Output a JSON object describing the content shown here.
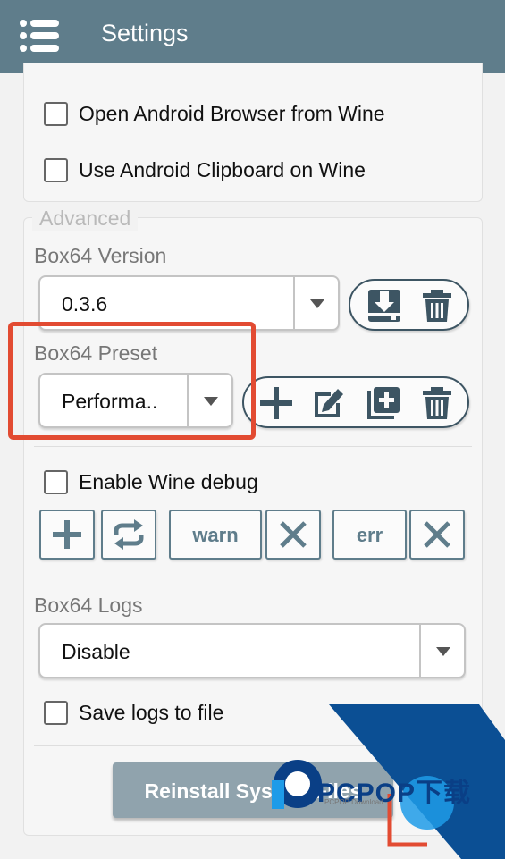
{
  "header": {
    "title": "Settings",
    "menu_icon": "menu-icon"
  },
  "wine_options": {
    "open_browser_label": "Open Android Browser from Wine",
    "open_browser_checked": false,
    "clipboard_label": "Use Android Clipboard on Wine",
    "clipboard_checked": false
  },
  "advanced": {
    "legend": "Advanced",
    "box64_version": {
      "label": "Box64 Version",
      "value": "0.3.6",
      "actions": [
        "download-icon",
        "trash-icon"
      ]
    },
    "box64_preset": {
      "label": "Box64 Preset",
      "value": "Performa..",
      "actions": [
        "plus-icon",
        "edit-icon",
        "duplicate-icon",
        "trash-icon"
      ]
    },
    "wine_debug": {
      "label": "Enable Wine debug",
      "checked": false,
      "channels": [
        "warn",
        "err"
      ]
    },
    "box64_logs": {
      "label": "Box64 Logs",
      "value": "Disable",
      "save_label": "Save logs to file",
      "save_checked": false
    },
    "reinstall_label": "Reinstall System Files"
  },
  "watermark": {
    "brand": "PCPOP下载",
    "sub": "PCPOP Download"
  },
  "colors": {
    "header": "#5f7d8b",
    "accent_dark": "#3d5563",
    "highlight": "#e24b32",
    "button_disabled": "#90a3ad"
  }
}
